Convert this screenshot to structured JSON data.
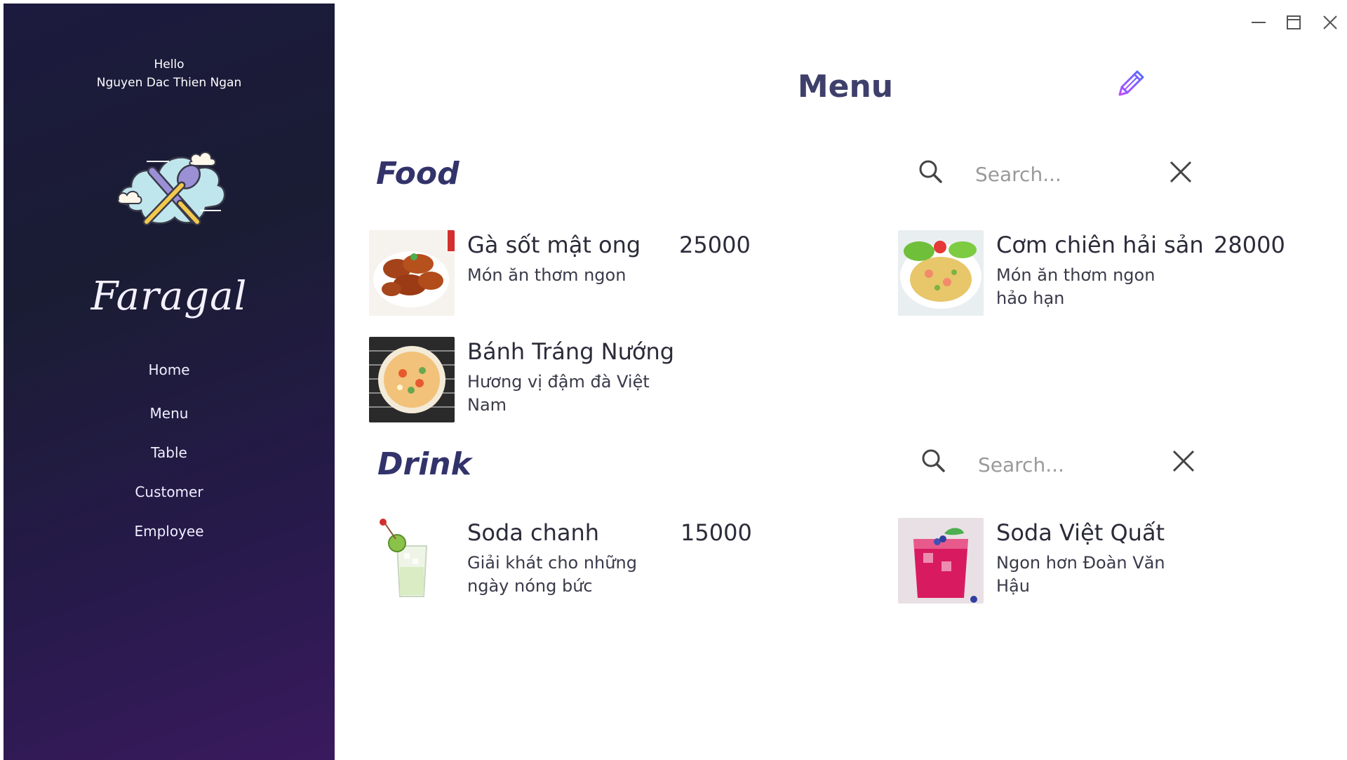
{
  "window": {
    "controls": [
      "minimize",
      "maximize",
      "close"
    ]
  },
  "sidebar": {
    "greeting": "Hello",
    "user_name": "Nguyen Dac Thien Ngan",
    "brand": "Faragal",
    "nav": [
      {
        "label": "Home"
      },
      {
        "label": "Menu"
      },
      {
        "label": "Table"
      },
      {
        "label": "Customer"
      },
      {
        "label": "Employee"
      }
    ]
  },
  "main": {
    "title": "Menu",
    "food": {
      "title": "Food",
      "search_placeholder": "Search...",
      "items": [
        {
          "name": "Gà sốt mật ong",
          "desc": "Món ăn thơm ngon",
          "price": "25000"
        },
        {
          "name": "Cơm chiên hải sản",
          "desc": "Món ăn thơm ngon hảo hạn",
          "price": "28000"
        },
        {
          "name": "Bánh Tráng Nướng",
          "desc": "Hương vị đậm đà Việt Nam",
          "price": ""
        }
      ]
    },
    "drink": {
      "title": "Drink",
      "search_placeholder": "Search...",
      "items": [
        {
          "name": "Soda chanh",
          "desc": "Giải khát cho những ngày nóng bức",
          "price": "15000"
        },
        {
          "name": "Soda Việt Quất",
          "desc": "Ngon hơn Đoàn Văn Hậu",
          "price": ""
        }
      ]
    }
  },
  "colors": {
    "sidebar_top": "#1c1a3e",
    "sidebar_bottom": "#3a1a5e",
    "title": "#3f3f6b",
    "section_title": "#33336b",
    "edit_icon": "#7a4cff"
  }
}
